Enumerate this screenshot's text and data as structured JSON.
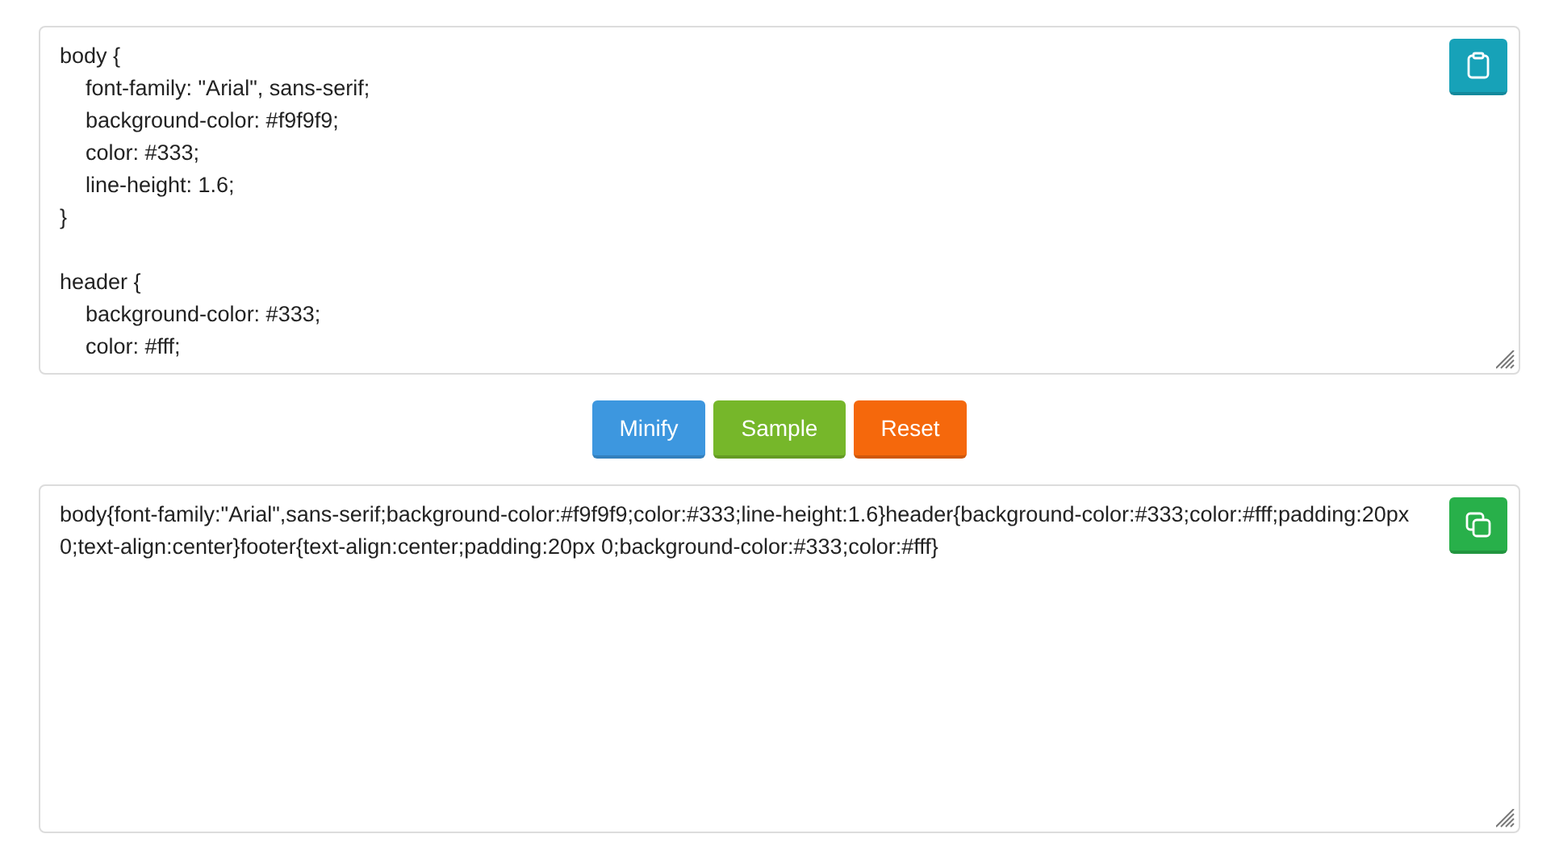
{
  "input": {
    "lines": [
      {
        "kind": "selector",
        "text": "body {"
      },
      {
        "kind": "property",
        "text": "font-family: \"Arial\", sans-serif;"
      },
      {
        "kind": "property",
        "text": "background-color: #f9f9f9;"
      },
      {
        "kind": "property",
        "text": "color: #333;"
      },
      {
        "kind": "property",
        "text": "line-height: 1.6;"
      },
      {
        "kind": "selector",
        "text": "}"
      },
      {
        "kind": "blank"
      },
      {
        "kind": "selector",
        "text": "header {"
      },
      {
        "kind": "property",
        "text": "background-color: #333;"
      },
      {
        "kind": "property",
        "text": "color: #fff;"
      }
    ]
  },
  "buttons": [
    {
      "label": "Minify",
      "color": "#3d97df"
    },
    {
      "label": "Sample",
      "color": "#76b72a"
    },
    {
      "label": "Reset",
      "color": "#f5680c"
    }
  ],
  "output": {
    "text": "body{font-family:\"Arial\",sans-serif;background-color:#f9f9f9;color:#333;line-height:1.6}header{background-color:#333;color:#fff;padding:20px 0;text-align:center}footer{text-align:center;padding:20px 0;background-color:#333;color:#fff}"
  }
}
